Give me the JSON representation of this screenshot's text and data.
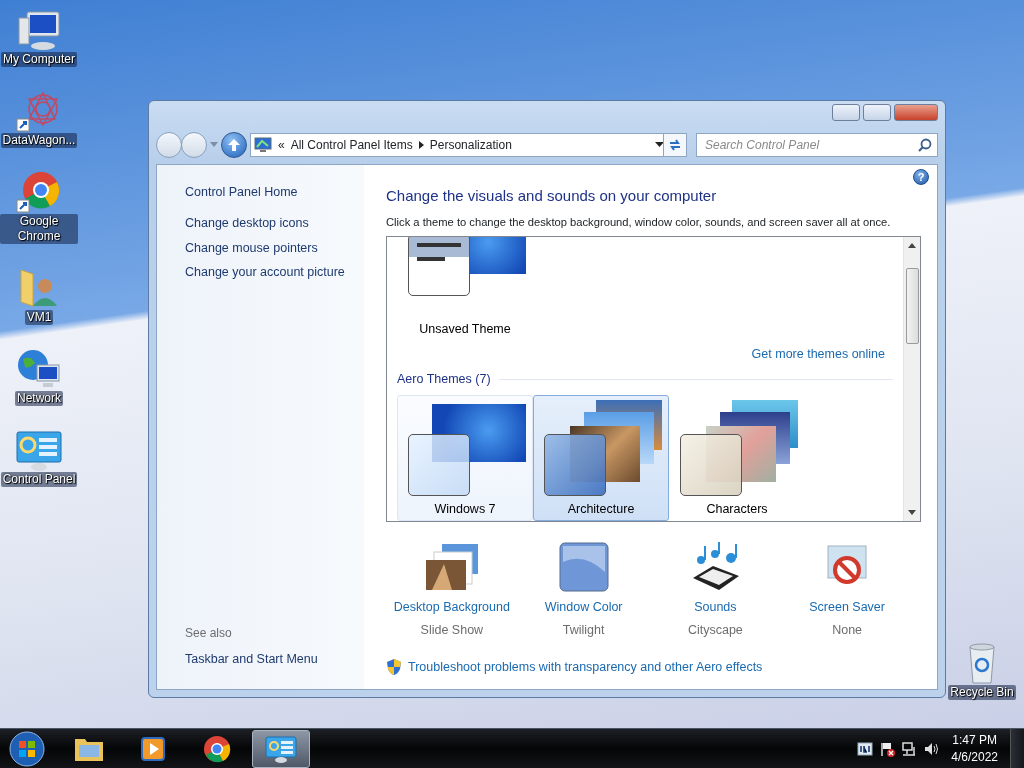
{
  "desktop_icons": [
    {
      "label": "My Computer",
      "kind": "computer"
    },
    {
      "label": "DataWagon...",
      "kind": "app"
    },
    {
      "label": "Google Chrome",
      "kind": "chrome"
    },
    {
      "label": "VM1",
      "kind": "user-folder"
    },
    {
      "label": "Network",
      "kind": "network"
    },
    {
      "label": "Control Panel",
      "kind": "control-panel"
    }
  ],
  "recycle_bin": {
    "label": "Recycle Bin"
  },
  "window": {
    "address": {
      "overflow": "«",
      "crumbs": [
        "All Control Panel Items",
        "Personalization"
      ]
    },
    "search": {
      "placeholder": "Search Control Panel"
    },
    "help": "?",
    "sidebar": {
      "home": "Control Panel Home",
      "links": [
        "Change desktop icons",
        "Change mouse pointers",
        "Change your account picture"
      ],
      "see_also": "See also",
      "see_also_links": [
        "Taskbar and Start Menu"
      ]
    },
    "heading": "Change the visuals and sounds on your computer",
    "description": "Click a theme to change the desktop background, window color, sounds, and screen saver all at once.",
    "my_themes": [
      {
        "name": "Unsaved Theme",
        "kind": "custom",
        "selected": false,
        "hovered": false
      }
    ],
    "get_more": "Get more themes online",
    "groups": [
      {
        "title": "Aero Themes (7)",
        "themes": [
          {
            "name": "Windows 7",
            "kind": "windows",
            "selected": false,
            "hovered": true
          },
          {
            "name": "Architecture",
            "kind": "architecture",
            "selected": true,
            "hovered": false
          },
          {
            "name": "Characters",
            "kind": "characters",
            "selected": false,
            "hovered": false
          }
        ]
      }
    ],
    "settings": [
      {
        "kind": "background",
        "label": "Desktop Background",
        "value": "Slide Show"
      },
      {
        "kind": "color",
        "label": "Window Color",
        "value": "Twilight"
      },
      {
        "kind": "sounds",
        "label": "Sounds",
        "value": "Cityscape"
      },
      {
        "kind": "screensaver",
        "label": "Screen Saver",
        "value": "None"
      }
    ],
    "troubleshoot": "Troubleshoot problems with transparency and other Aero effects"
  },
  "taskbar": {
    "pinned": [
      {
        "kind": "explorer",
        "active": false
      },
      {
        "kind": "media",
        "active": false
      },
      {
        "kind": "chrome",
        "active": false
      },
      {
        "kind": "control-panel",
        "active": true
      }
    ],
    "time": "1:47 PM",
    "date": "4/6/2022"
  }
}
